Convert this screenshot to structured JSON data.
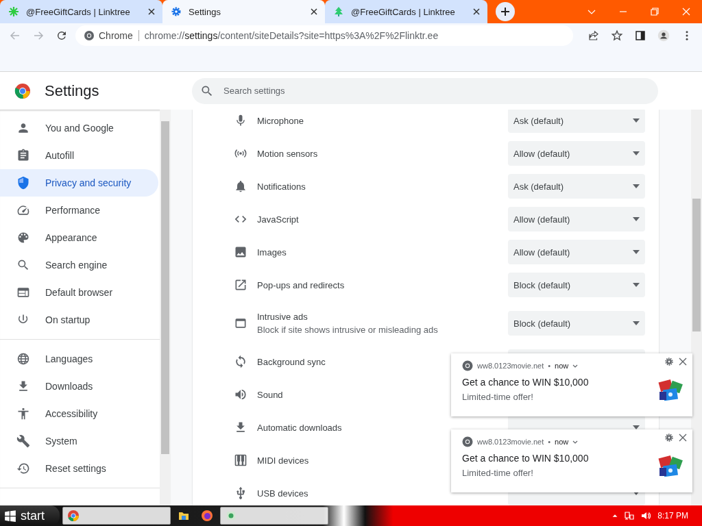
{
  "tabs": [
    {
      "title": "@FreeGiftCards | Linktree",
      "kind": "burst",
      "selected": false
    },
    {
      "title": "Settings",
      "kind": "gear",
      "selected": true
    },
    {
      "title": "@FreeGiftCards | Linktree",
      "kind": "tree",
      "selected": false
    }
  ],
  "toolbar": {
    "site_label": "Chrome",
    "url": {
      "scheme": "chrome://",
      "host": "settings",
      "path": "/content/siteDetails?site=https%3A%2F%2Flinktr.ee"
    }
  },
  "header": {
    "title": "Settings",
    "search": {
      "placeholder": "Search settings"
    }
  },
  "sidebar": {
    "sections": [
      {
        "items": [
          {
            "label": "You and Google",
            "kind": "person",
            "selected": false
          },
          {
            "label": "Autofill",
            "kind": "autofill",
            "selected": false
          },
          {
            "label": "Privacy and security",
            "kind": "privacy",
            "selected": true
          },
          {
            "label": "Performance",
            "kind": "performance",
            "selected": false
          },
          {
            "label": "Appearance",
            "kind": "appearance",
            "selected": false
          },
          {
            "label": "Search engine",
            "kind": "search",
            "selected": false
          },
          {
            "label": "Default browser",
            "kind": "browser",
            "selected": false
          },
          {
            "label": "On startup",
            "kind": "startup",
            "selected": false
          }
        ]
      },
      {
        "items": [
          {
            "label": "Languages",
            "kind": "languages",
            "selected": false
          },
          {
            "label": "Downloads",
            "kind": "downloads",
            "selected": false
          },
          {
            "label": "Accessibility",
            "kind": "accessibility",
            "selected": false
          },
          {
            "label": "System",
            "kind": "system",
            "selected": false
          },
          {
            "label": "Reset settings",
            "kind": "reset",
            "selected": false
          }
        ]
      }
    ]
  },
  "permissions": [
    {
      "label": "Microphone",
      "kind": "microphone",
      "value": "Ask (default)"
    },
    {
      "label": "Motion sensors",
      "kind": "sensors",
      "value": "Allow (default)"
    },
    {
      "label": "Notifications",
      "kind": "notifications",
      "value": "Ask (default)"
    },
    {
      "label": "JavaScript",
      "kind": "javascript",
      "value": "Allow (default)"
    },
    {
      "label": "Images",
      "kind": "images",
      "value": "Allow (default)"
    },
    {
      "label": "Pop-ups and redirects",
      "kind": "popups",
      "value": "Block (default)"
    },
    {
      "label": "Intrusive ads",
      "description": "Block if site shows intrusive or misleading ads",
      "kind": "ads",
      "value": "Block (default)"
    },
    {
      "label": "Background sync",
      "kind": "sync",
      "dropdown": true,
      "caret": false
    },
    {
      "label": "Sound",
      "kind": "sound"
    },
    {
      "label": "Automatic downloads",
      "kind": "downloads",
      "dropdown": true,
      "caret": true
    },
    {
      "label": "MIDI devices",
      "kind": "midi"
    },
    {
      "label": "USB devices",
      "kind": "usb",
      "dropdown": true,
      "caret": true
    }
  ],
  "notifications": [
    {
      "site": "ww8.0123movie.net",
      "separator": "•",
      "time": "now",
      "title": "Get a chance to WIN $10,000",
      "body": "Limited-time offer!"
    },
    {
      "site": "ww8.0123movie.net",
      "separator": "•",
      "time": "now",
      "title": "Get a chance to WIN $10,000",
      "body": "Limited-time offer!"
    }
  ],
  "taskbar": {
    "start": "start",
    "tasks": [
      {
        "kind": "chrome"
      },
      {
        "kind": "folder"
      },
      {
        "kind": "firefox"
      },
      {
        "kind": "app"
      }
    ],
    "clock": "8:17 PM"
  }
}
